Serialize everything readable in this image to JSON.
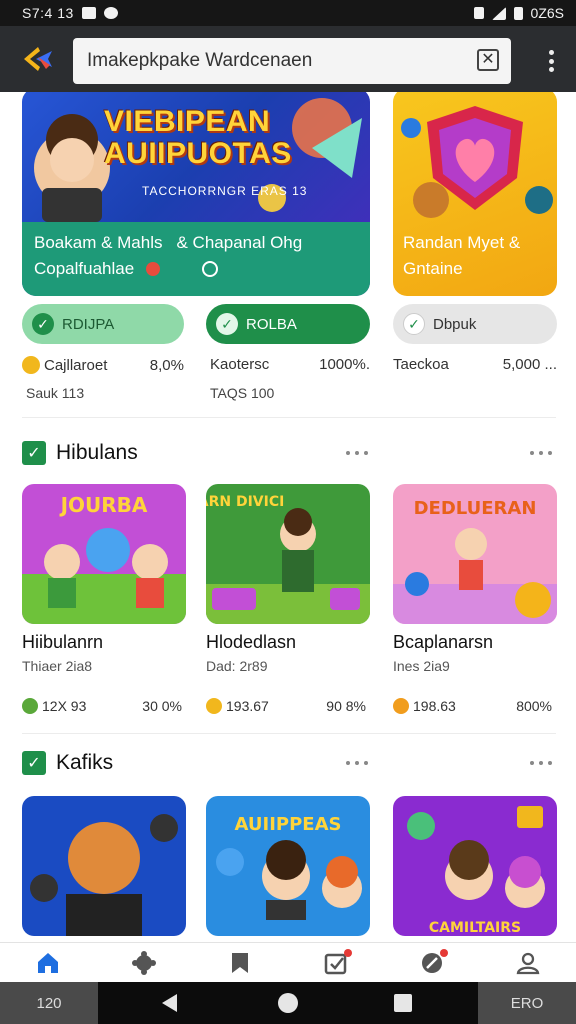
{
  "status_bar": {
    "time": "S7:4 13",
    "right_text": "0Z6S"
  },
  "search": {
    "value": "Imakepkpake Wardcenaen"
  },
  "featured": [
    {
      "banner_title_line1": "VIEBIPEAN",
      "banner_title_line2": "AUIIPUOTAS",
      "banner_subtitle": "TACCHORRNGR ERAS 13",
      "caption_line1": "Boakam & Mahls",
      "caption_line2": "Copalfuahlae"
    },
    {
      "caption_line1": "& Chapanal Ohg",
      "caption_line2": ""
    },
    {
      "caption_line1": "Randan Myet &",
      "caption_line2": "Gntaine"
    }
  ],
  "chips": [
    {
      "label": "RDIJPA"
    },
    {
      "label": "ROLBA"
    },
    {
      "label": "Dbpuk"
    }
  ],
  "featured_stats": [
    {
      "name": "Cajllaroet",
      "value": "8,0%",
      "sub": "Sauk 113"
    },
    {
      "name": "Kaotersc",
      "value": "1000%.",
      "sub": "TAQS 100"
    },
    {
      "name": "Taeckoa",
      "value": "5,000 ...",
      "sub": ""
    }
  ],
  "sections": [
    {
      "title": "Hibulans",
      "tiles": [
        {
          "banner": "JOURBA",
          "title": "Hiibulanrn",
          "sub": "Thiaer 2ia8",
          "stat": "12X 93",
          "pct": "30 0%",
          "dot_color": "#5aa83a"
        },
        {
          "banner": "SARN DIVICI",
          "title": "Hlodedlasn",
          "sub": "Dad: 2r89",
          "stat": "193.67",
          "pct": "90 8%",
          "dot_color": "#f1b71d"
        },
        {
          "banner": "DEDLUERAN",
          "title": "Bcaplanarsn",
          "sub": "Ines 2ia9",
          "stat": "198.63",
          "pct": "800%",
          "dot_color": "#f19d1d"
        }
      ]
    },
    {
      "title": "Kafiks",
      "tiles": [
        {
          "banner": "",
          "title": "",
          "sub": "",
          "stat": "",
          "pct": ""
        },
        {
          "banner": "AUIIPPEAS",
          "title": "",
          "sub": "",
          "stat": "",
          "pct": ""
        },
        {
          "banner": "CAMILTAIRS",
          "title": "",
          "sub": "",
          "stat": "",
          "pct": ""
        }
      ]
    }
  ],
  "system_nav": {
    "left_label": "120",
    "right_label": "ERO"
  },
  "colors": {
    "app_bar": "#2b2d30",
    "accent_green": "#1f8f4a",
    "teal": "#1e9a78"
  }
}
